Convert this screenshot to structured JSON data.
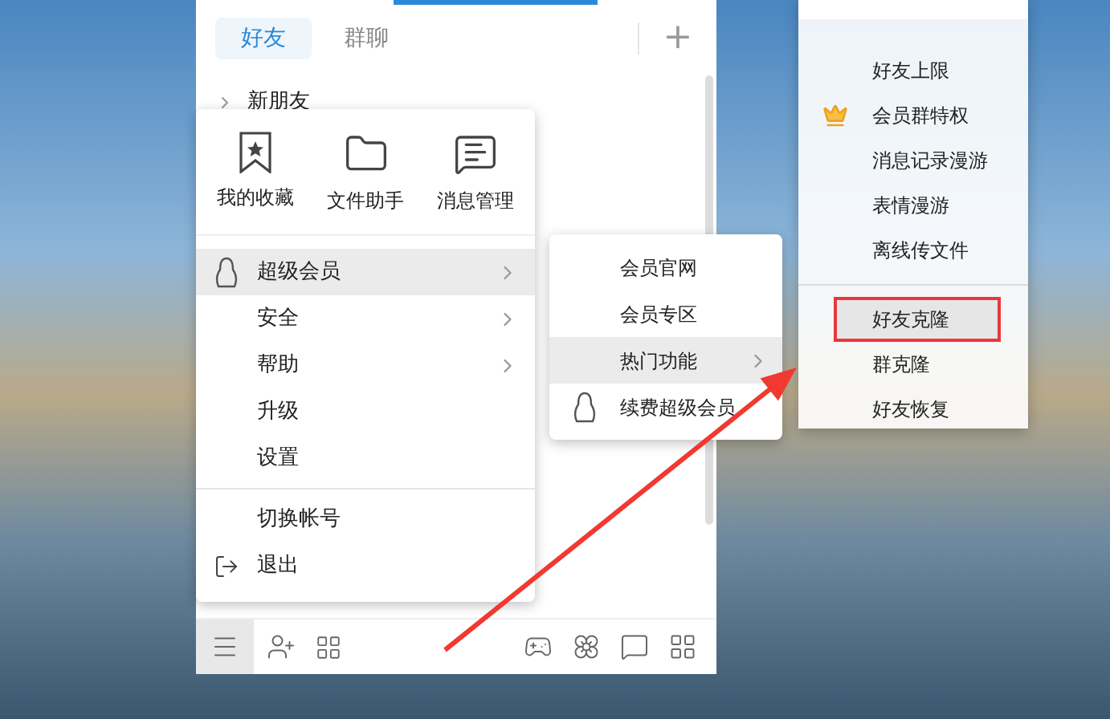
{
  "panel": {
    "tabs": [
      {
        "label": "好友",
        "selected": true
      },
      {
        "label": "群聊",
        "selected": false
      }
    ],
    "add_button": "+",
    "list": [
      {
        "label": "新朋友"
      }
    ],
    "toolbar": {
      "menu_active": true
    }
  },
  "main_menu": {
    "shortcuts": [
      {
        "label": "我的收藏",
        "kind": "bookmark"
      },
      {
        "label": "文件助手",
        "kind": "folder"
      },
      {
        "label": "消息管理",
        "kind": "message"
      }
    ],
    "items": [
      {
        "label": "超级会员",
        "kind": "penguin",
        "submenu": true,
        "selected": true,
        "divider_before": false
      },
      {
        "label": "安全",
        "kind": "plain",
        "submenu": true,
        "selected": false,
        "divider_before": false
      },
      {
        "label": "帮助",
        "kind": "plain",
        "submenu": true,
        "selected": false,
        "divider_before": false
      },
      {
        "label": "升级",
        "kind": "plain",
        "submenu": false,
        "selected": false,
        "divider_before": false
      },
      {
        "label": "设置",
        "kind": "plain",
        "submenu": false,
        "selected": false,
        "divider_before": false
      },
      {
        "label": "切换帐号",
        "kind": "plain",
        "submenu": false,
        "selected": false,
        "divider_before": true
      },
      {
        "label": "退出",
        "kind": "exit",
        "submenu": false,
        "selected": false,
        "divider_before": false
      }
    ]
  },
  "submenu": {
    "items": [
      {
        "label": "会员官网",
        "kind": "plain",
        "submenu": false,
        "selected": false
      },
      {
        "label": "会员专区",
        "kind": "plain",
        "submenu": false,
        "selected": false
      },
      {
        "label": "热门功能",
        "kind": "plain",
        "submenu": true,
        "selected": true
      },
      {
        "label": "续费超级会员",
        "kind": "penguin",
        "submenu": false,
        "selected": false
      }
    ]
  },
  "feature_menu": {
    "items": [
      {
        "label": "好友上限",
        "kind": "plain",
        "selected": false,
        "annotated": false,
        "divider_before": false
      },
      {
        "label": "会员群特权",
        "kind": "crown",
        "selected": false,
        "annotated": false,
        "divider_before": false
      },
      {
        "label": "消息记录漫游",
        "kind": "plain",
        "selected": false,
        "annotated": false,
        "divider_before": false
      },
      {
        "label": "表情漫游",
        "kind": "plain",
        "selected": false,
        "annotated": false,
        "divider_before": false
      },
      {
        "label": "离线传文件",
        "kind": "plain",
        "selected": false,
        "annotated": false,
        "divider_before": false
      },
      {
        "label": "好友克隆",
        "kind": "plain",
        "selected": true,
        "annotated": true,
        "divider_before": true
      },
      {
        "label": "群克隆",
        "kind": "plain",
        "selected": false,
        "annotated": false,
        "divider_before": false
      },
      {
        "label": "好友恢复",
        "kind": "plain",
        "selected": false,
        "annotated": false,
        "divider_before": false
      }
    ]
  }
}
